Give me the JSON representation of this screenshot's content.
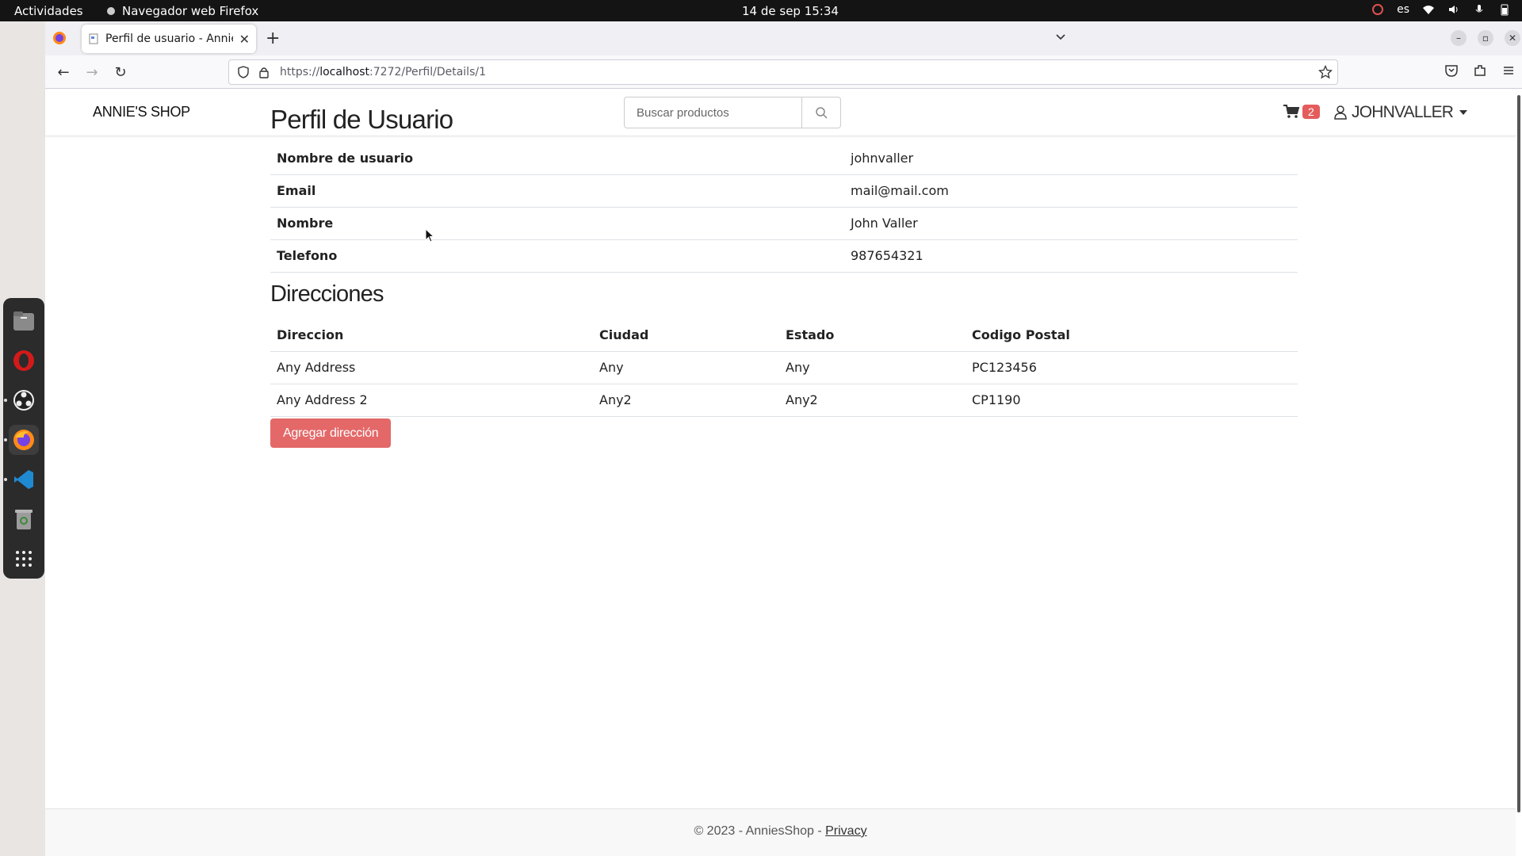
{
  "system": {
    "activities": "Actividades",
    "app_name": "Navegador web Firefox",
    "clock": "14 de sep  15:34",
    "language": "es"
  },
  "browser": {
    "tab_title": "Perfil de usuario - Annie's Shop",
    "url_prefix": "https://",
    "url_host": "localhost",
    "url_path": ":7272/Perfil/Details/1"
  },
  "site": {
    "brand": "ANNIE'S SHOP",
    "search_placeholder": "Buscar productos",
    "cart_count": "2",
    "username": "JOHNVALLER"
  },
  "profile": {
    "title": "Perfil de Usuario",
    "rows": [
      {
        "label": "Nombre de usuario",
        "value": "johnvaller"
      },
      {
        "label": "Email",
        "value": "mail@mail.com"
      },
      {
        "label": "Nombre",
        "value": "John Valler"
      },
      {
        "label": "Telefono",
        "value": "987654321"
      }
    ]
  },
  "addresses": {
    "title": "Direcciones",
    "headers": [
      "Direccion",
      "Ciudad",
      "Estado",
      "Codigo Postal"
    ],
    "rows": [
      [
        "Any Address",
        "Any",
        "Any",
        "PC123456"
      ],
      [
        "Any Address 2",
        "Any2",
        "Any2",
        "CP1190"
      ]
    ],
    "add_button": "Agregar dirección"
  },
  "footer": {
    "text": "© 2023 - AnniesShop - ",
    "privacy": "Privacy"
  },
  "colors": {
    "accent": "#e46868",
    "badge": "#e45c5c"
  },
  "icons": [
    "firefox-icon",
    "search-icon",
    "cart-icon",
    "user-icon",
    "star-icon",
    "shield-icon",
    "lock-icon"
  ]
}
